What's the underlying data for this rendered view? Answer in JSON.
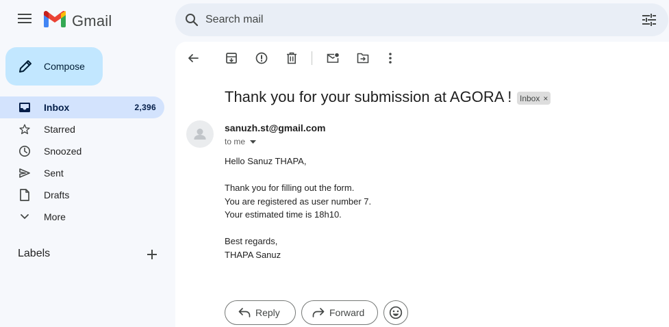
{
  "app": {
    "brand": "Gmail",
    "colors": {
      "accent": "#c2e7ff",
      "active_nav": "#d3e3fd",
      "search_bg": "#e9eef6",
      "page_bg": "#f6f8fc"
    }
  },
  "header": {
    "menu_icon": "hamburger-icon",
    "logo_text": "Gmail",
    "search": {
      "placeholder": "Search mail",
      "value": ""
    },
    "search_icon": "search-icon",
    "filter_icon": "tune-icon"
  },
  "compose": {
    "label": "Compose",
    "icon": "pencil-icon"
  },
  "sidebar": {
    "items": [
      {
        "label": "Inbox",
        "count": "2,396",
        "icon": "inbox-icon",
        "active": true
      },
      {
        "label": "Starred",
        "icon": "star-icon"
      },
      {
        "label": "Snoozed",
        "icon": "clock-icon"
      },
      {
        "label": "Sent",
        "icon": "send-icon"
      },
      {
        "label": "Drafts",
        "icon": "draft-icon"
      },
      {
        "label": "More",
        "icon": "chevron-down-icon"
      }
    ],
    "labels_title": "Labels"
  },
  "toolbar": {
    "buttons": [
      "back-icon",
      "archive-icon",
      "report-spam-icon",
      "delete-icon",
      "mark-unread-icon",
      "move-to-icon",
      "more-vert-icon"
    ]
  },
  "email": {
    "subject": "Thank you for your submission at AGORA !",
    "label_badge": "Inbox",
    "badge_close": "×",
    "sender": "sanuzh.st@gmail.com",
    "recipient": "to me",
    "body": {
      "greeting": "Hello Sanuz THAPA,",
      "line1": "Thank you for filling out the form.",
      "line2": "You are registered as user number 7.",
      "line3": "Your estimated time is 18h10.",
      "closing": "Best regards,",
      "signature": "THAPA Sanuz"
    }
  },
  "actions": {
    "reply": "Reply",
    "forward": "Forward",
    "emoji_icon": "emoji-icon"
  }
}
